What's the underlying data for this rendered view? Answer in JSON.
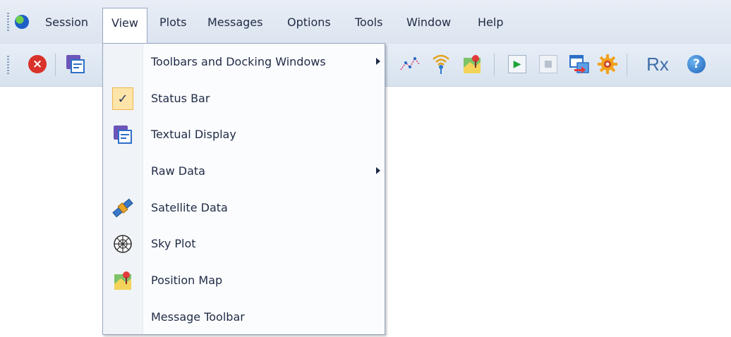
{
  "menubar": {
    "items": [
      "Session",
      "View",
      "Plots",
      "Messages",
      "Options",
      "Tools",
      "Window",
      "Help"
    ],
    "active": "View"
  },
  "toolbar": {
    "rx_label": "Rx",
    "help_label": "?",
    "close_label": "×"
  },
  "view_menu": {
    "items": [
      {
        "label": "Toolbars and Docking Windows",
        "submenu": true
      },
      {
        "label": "Status Bar",
        "checked": true
      },
      {
        "label": "Textual Display",
        "icon": "textual-display-icon"
      },
      {
        "label": "Raw Data",
        "submenu": true
      },
      {
        "label": "Satellite Data",
        "icon": "satellite-icon"
      },
      {
        "label": "Sky Plot",
        "icon": "sky-plot-icon"
      },
      {
        "label": "Position Map",
        "icon": "position-map-icon"
      },
      {
        "label": "Message Toolbar"
      }
    ],
    "check_mark": "✓"
  },
  "colors": {
    "accent": "#fde4a9",
    "menu_text": "#1f2b45",
    "close": "#d9322b"
  }
}
